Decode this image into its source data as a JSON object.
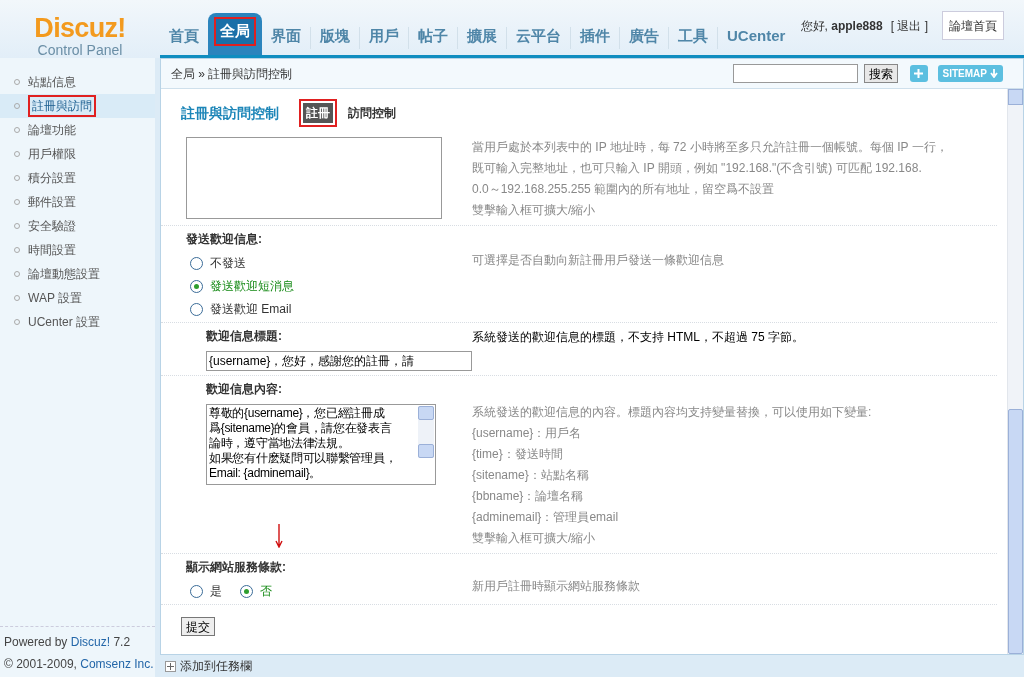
{
  "logo": {
    "title": "Discuz!",
    "subtitle": "Control Panel"
  },
  "nav": {
    "tabs": [
      {
        "label": "首頁",
        "selected": false
      },
      {
        "label": "全局",
        "selected": true
      },
      {
        "label": "界面",
        "selected": false
      },
      {
        "label": "版塊",
        "selected": false
      },
      {
        "label": "用戶",
        "selected": false
      },
      {
        "label": "帖子",
        "selected": false
      },
      {
        "label": "擴展",
        "selected": false
      },
      {
        "label": "云平台",
        "selected": false
      },
      {
        "label": "插件",
        "selected": false
      },
      {
        "label": "廣告",
        "selected": false
      },
      {
        "label": "工具",
        "selected": false
      },
      {
        "label": "UCenter",
        "selected": false
      }
    ]
  },
  "user": {
    "greeting": "您好,",
    "username": "apple888",
    "logout": "[ 退出 ]",
    "forum_home": "論壇首頁"
  },
  "breadcrumb": "全局 » 註冊與訪問控制",
  "search": {
    "button": "搜索"
  },
  "sitemap": "SITEMAP",
  "sidebar": {
    "items": [
      {
        "label": "站點信息",
        "selected": false
      },
      {
        "label": "註冊與訪問",
        "selected": true
      },
      {
        "label": "論壇功能",
        "selected": false
      },
      {
        "label": "用戶權限",
        "selected": false
      },
      {
        "label": "積分設置",
        "selected": false
      },
      {
        "label": "郵件設置",
        "selected": false
      },
      {
        "label": "安全驗證",
        "selected": false
      },
      {
        "label": "時間設置",
        "selected": false
      },
      {
        "label": "論壇動態設置",
        "selected": false
      },
      {
        "label": "WAP 設置",
        "selected": false
      },
      {
        "label": "UCenter 設置",
        "selected": false
      }
    ]
  },
  "page": {
    "title": "註冊與訪問控制",
    "tabs": [
      {
        "label": "註冊",
        "selected": true
      },
      {
        "label": "訪問控制",
        "selected": false
      }
    ]
  },
  "settings": [
    {
      "kind": "textarea",
      "description": [
        "當用戶處於本列表中的 IP 地址時，每 72 小時將至多只允許註冊一個帳號。每個 IP 一行，",
        "既可輸入完整地址，也可只輸入 IP 開頭，例如 \"192.168.\"(不含引號) 可匹配 192.168.",
        "0.0～192.168.255.255 範圍內的所有地址，留空爲不設置",
        "雙擊輸入框可擴大/縮小"
      ]
    },
    {
      "kind": "radio",
      "label": "發送歡迎信息:",
      "inline": false,
      "options": [
        {
          "label": "不發送",
          "selected": false
        },
        {
          "label": "發送歡迎短消息",
          "selected": true
        },
        {
          "label": "發送歡迎 Email",
          "selected": false
        }
      ],
      "description": [
        "可選擇是否自動向新註冊用戶發送一條歡迎信息"
      ]
    },
    {
      "kind": "input",
      "label": "歡迎信息標題:",
      "value": "{username}，您好，感謝您的註冊，請",
      "description": [
        "系統發送的歡迎信息的標題，不支持 HTML，不超過 75 字節。"
      ]
    },
    {
      "kind": "textarea",
      "label": "歡迎信息內容:",
      "lines": [
        "尊敬的{username}，您已經註冊成",
        "爲{sitename}的會員，請您在發表言",
        "論時，遵守當地法律法規。",
        "如果您有什麽疑問可以聯繫管理員，",
        "Email: {adminemail}。"
      ],
      "description": [
        "系統發送的歡迎信息的內容。標題內容均支持變量替換，可以使用如下變量:",
        "{username}：用戶名",
        "{time}：發送時間",
        "{sitename}：站點名稱",
        "{bbname}：論壇名稱",
        "{adminemail}：管理員email",
        "雙擊輸入框可擴大/縮小"
      ]
    },
    {
      "kind": "radio",
      "label": "顯示網站服務條款:",
      "inline": true,
      "options": [
        {
          "label": "是",
          "selected": false
        },
        {
          "label": "否",
          "selected": true
        }
      ],
      "description": [
        "新用戶註冊時顯示網站服務條款"
      ]
    }
  ],
  "submit": "提交",
  "footer": {
    "powered_prefix": "Powered by",
    "powered_link": "Discuz!",
    "powered_suffix": "7.2",
    "copyright_prefix": "© 2001-2009,",
    "copyright_link": "Comsenz Inc.",
    "taskbar": "添加到任務欄"
  }
}
